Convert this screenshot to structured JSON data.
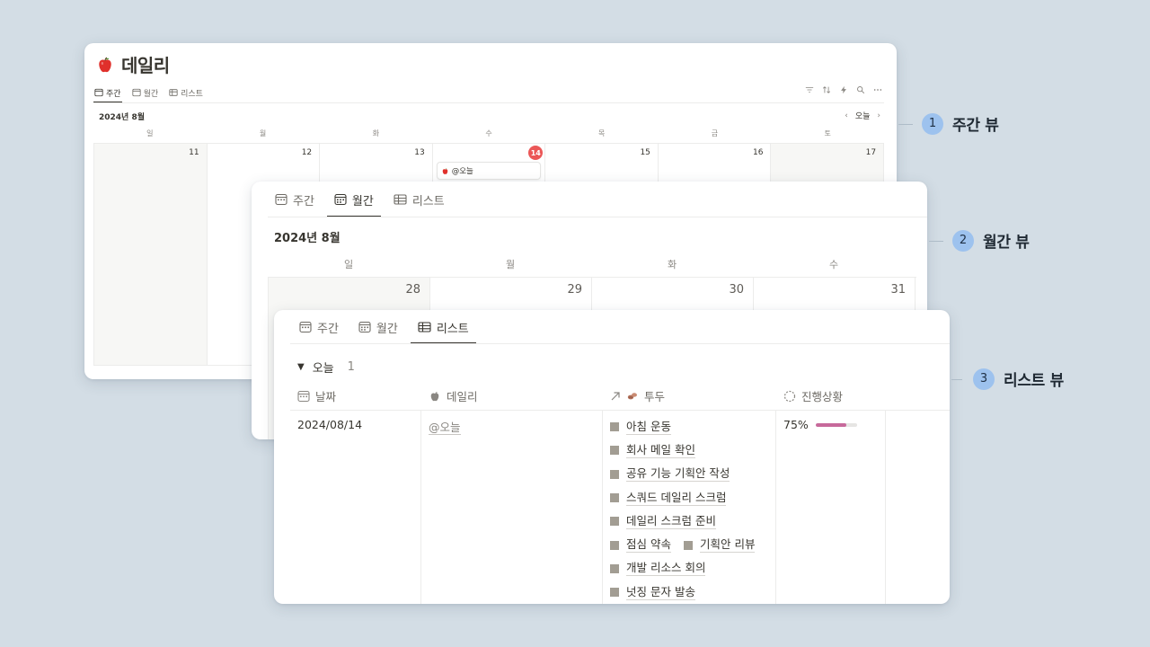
{
  "colors": {
    "background": "#d3dde5",
    "today_badge": "#eb5757",
    "progress_fill": "#c7699b",
    "callout_badge": "#9dc2ee"
  },
  "weekly": {
    "title_icon": "apple-icon",
    "title": "데일리",
    "tabs": [
      {
        "label": "주간",
        "icon": "calendar-week-icon",
        "active": true
      },
      {
        "label": "월간",
        "icon": "calendar-month-icon",
        "active": false
      },
      {
        "label": "리스트",
        "icon": "table-icon",
        "active": false
      }
    ],
    "toolbar_icons": [
      "filter-icon",
      "sort-icon",
      "lightning-icon",
      "search-icon",
      "more-icon"
    ],
    "month_label": "2024년 8월",
    "today_label": "오늘",
    "weekdays": [
      "일",
      "월",
      "화",
      "수",
      "목",
      "금",
      "토"
    ],
    "days": [
      "11",
      "12",
      "13",
      "14",
      "15",
      "16",
      "17"
    ],
    "event": {
      "label": "@오늘"
    }
  },
  "monthly": {
    "tabs": [
      {
        "label": "주간",
        "icon": "calendar-week-icon",
        "active": false
      },
      {
        "label": "월간",
        "icon": "calendar-month-icon",
        "active": true
      },
      {
        "label": "리스트",
        "icon": "table-icon",
        "active": false
      }
    ],
    "month_label": "2024년 8월",
    "weekdays": [
      "일",
      "월",
      "화",
      "수"
    ],
    "days": [
      "28",
      "29",
      "30",
      "31"
    ]
  },
  "list": {
    "tabs": [
      {
        "label": "주간",
        "icon": "calendar-week-icon",
        "active": false
      },
      {
        "label": "월간",
        "icon": "calendar-month-icon",
        "active": false
      },
      {
        "label": "리스트",
        "icon": "table-icon",
        "active": true
      }
    ],
    "group": {
      "label": "오늘",
      "count": "1"
    },
    "columns": [
      {
        "label": "날짜",
        "icon": "calendar-icon"
      },
      {
        "label": "데일리",
        "icon": "apple-icon"
      },
      {
        "label": "투두",
        "icon": "relation-arrow-icon"
      },
      {
        "label": "진행상황",
        "icon": "progress-ring-icon"
      }
    ],
    "row": {
      "date": "2024/08/14",
      "daily": "@오늘",
      "todos": [
        "아침 운동",
        "회사 메일 확인",
        "공유 기능 기획안 작성",
        "스쿼드 데일리 스크럼",
        "데일리 스크럼 준비",
        "점심 약속",
        "기획안 리뷰",
        "개발 리소스 회의",
        "넛징 문자 발송"
      ],
      "progress_text": "75%",
      "progress_value": 0.75
    }
  },
  "callouts": [
    {
      "number": "1",
      "label": "주간 뷰"
    },
    {
      "number": "2",
      "label": "월간 뷰"
    },
    {
      "number": "3",
      "label": "리스트 뷰"
    }
  ]
}
